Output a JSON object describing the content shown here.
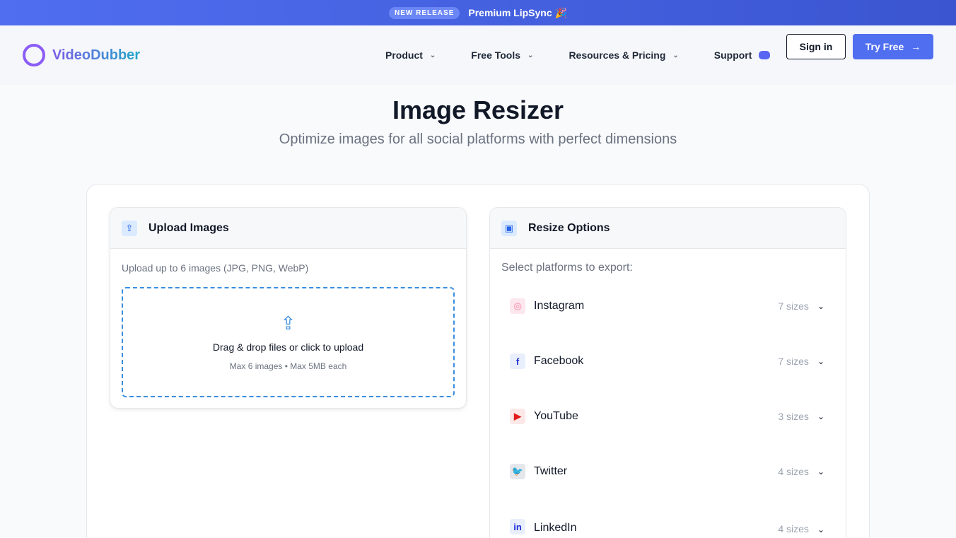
{
  "banner": {
    "badge": "NEW RELEASE",
    "text": "Premium LipSync 🎉"
  },
  "nav": {
    "logo": "VideoDubber",
    "items": [
      "Product",
      "Free Tools",
      "Resources & Pricing"
    ],
    "support": "Support",
    "sign_in": "Sign in",
    "try_free": "Try Free",
    "arrow": "→",
    "chevron": "⌄"
  },
  "page": {
    "title": "Image Resizer",
    "subtitle": "Optimize images for all social platforms with perfect dimensions"
  },
  "upload": {
    "title": "Upload Images",
    "hint": "Upload up to 6 images (JPG, PNG, WebP)",
    "drop_main": "Drag & drop files or click to upload",
    "drop_sub": "Max 6 images • Max 5MB each",
    "icon": "⇪"
  },
  "resize": {
    "title": "Resize Options",
    "hint": "Select platforms to export:",
    "platforms": [
      {
        "name": "Instagram",
        "sizes": "7 sizes",
        "glyph": "◎",
        "color": "#f9a8c0",
        "bg": "#fde7ee"
      },
      {
        "name": "Facebook",
        "sizes": "7 sizes",
        "glyph": "f",
        "color": "#1d2fd6",
        "bg": "#e8eefc"
      },
      {
        "name": "YouTube",
        "sizes": "3 sizes",
        "glyph": "▶",
        "color": "#e11d1d",
        "bg": "#fde8e8"
      },
      {
        "name": "Twitter",
        "sizes": "4 sizes",
        "glyph": "🐦",
        "color": "#111",
        "bg": "#e5e7eb"
      },
      {
        "name": "LinkedIn",
        "sizes": "4 sizes",
        "glyph": "in",
        "color": "#1d2fd6",
        "bg": "#e8eefc"
      }
    ]
  },
  "colors": {
    "accent": "#4f6ef0",
    "dashed": "#3b8ee0"
  }
}
